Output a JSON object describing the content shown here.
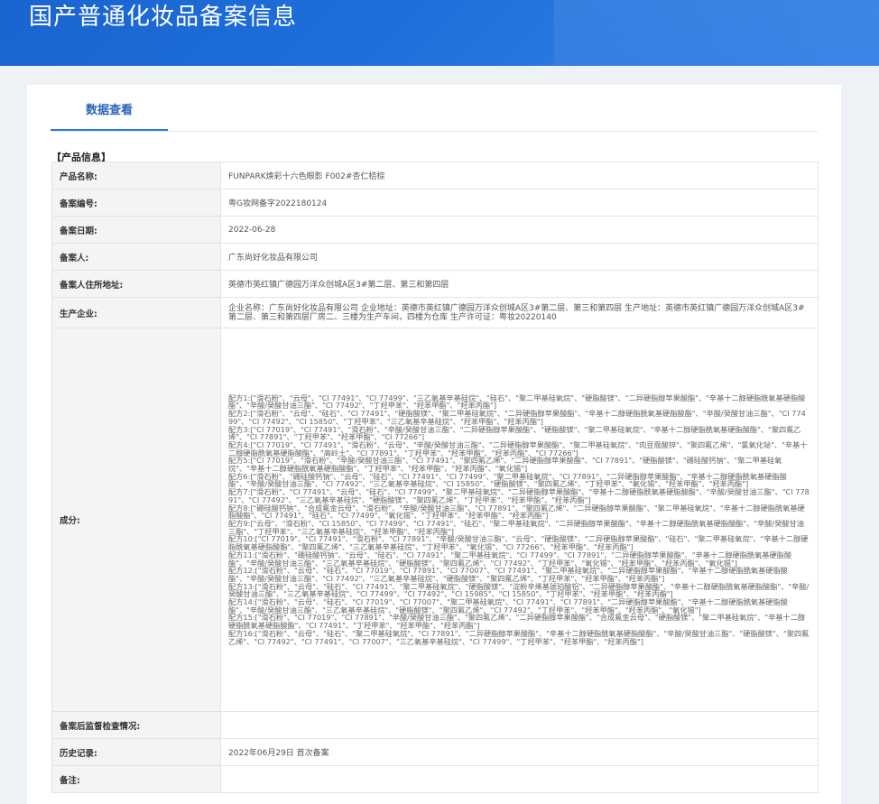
{
  "header": {
    "title": "国产普通化妆品备案信息"
  },
  "tabs": [
    {
      "label": "数据查看"
    }
  ],
  "section": {
    "title": "【产品信息】"
  },
  "fields": {
    "product_name": {
      "label": "产品名称:",
      "value": "FUNPARK焕彩十六色眼影 F002#杏仁桔棕"
    },
    "record_no": {
      "label": "备案编号:",
      "value": "粤G妆网备字2022180124"
    },
    "record_date": {
      "label": "备案日期:",
      "value": "2022-06-28"
    },
    "registrant": {
      "label": "备案人:",
      "value": "广东尚好化妆品有限公司"
    },
    "registrant_address": {
      "label": "备案人住所地址:",
      "value": "英德市英红镇广德园万洋众创城A区3#第二层、第三和第四层"
    },
    "manufacturer": {
      "label": "生产企业:",
      "value": "企业名称：广东尚好化妆品有限公司 企业地址：英德市英红镇广德园万洋众创城A区3#第二层、第三和第四层 生产地址：英德市英红镇广德园万洋众创城A区3#第二层、第三和第四层厂房二、三楼为生产车间，四楼为仓库 生产许可证：粤妆20220140"
    },
    "ingredients": {
      "label": "成分:",
      "lines": [
        "配方1:[\"滑石粉\"、\"云母\"、\"CI 77491\"、\"CI 77499\"、\"三乙氧基辛基硅烷\"、\"硅石\"、\"聚二甲基硅氧烷\"、\"硬脂酸镁\"、\"二异硬脂醇苹果酸酯\"、\"辛基十二醇硬脂酰氧基硬脂酸酯\"、\"辛酸/癸酸甘油三酯\"、\"CI 77492\"、\"丁羟甲苯\"、\"羟苯甲酯\"、\"羟苯丙酯\"]",
        "配方2:[\"滑石粉\"、\"云母\"、\"硅石\"、\"CI 77491\"、\"硬脂酸镁\"、\"聚二甲基硅氧烷\"、\"二异硬脂醇苹果酸酯\"、\"辛基十二醇硬脂酰氧基硬脂酸酯\"、\"辛酸/癸酸甘油三酯\"、\"CI 77499\"、\"CI 77492\"、\"CI 15850\"、\"丁羟甲苯\"、\"三乙氧基辛基硅烷\"、\"羟苯甲酯\"、\"羟苯丙酯\"]",
        "配方3:[\"CI 77019\"、\"CI 77491\"、\"滑石粉\"、\"辛酸/癸酸甘油三酯\"、\"二异硬脂醇苹果酸酯\"、\"硬脂酸镁\"、\"聚二甲基硅氧烷\"、\"辛基十二醇硬脂酰氧基硬脂酸酯\"、\"聚四氟乙烯\"、\"CI 77891\"、\"丁羟甲苯\"、\"羟苯甲酯\"、\"CI 77266\"]",
        "配方4:[\"CI 77019\"、\"CI 77491\"、\"滑石粉\"、\"云母\"、\"辛酸/癸酸甘油三酯\"、\"二异硬脂醇苹果酸酯\"、\"聚二甲基硅氧烷\"、\"肉豆蔻酸锌\"、\"聚四氟乙烯\"、\"氯氧化铋\"、\"辛基十二醇硬脂酰氧基硬脂酸酯\"、\"高岭土\"、\"CI 77891\"、\"丁羟甲苯\"、\"羟苯甲酯\"、\"羟苯丙酯\"、\"CI 77266\"]",
        "配方5:[\"CI 77019\"、\"滑石粉\"、\"辛酸/癸酸甘油三酯\"、\"CI 77491\"、\"聚四氟乙烯\"、\"二异硬脂醇苹果酸酯\"、\"CI 77891\"、\"硬脂酸镁\"、\"硼硅酸钙钠\"、\"聚二甲基硅氧烷\"、\"辛基十二醇硬脂酰氧基硬脂酸酯\"、\"丁羟甲苯\"、\"羟苯甲酯\"、\"羟苯丙酯\"、\"氧化锡\"]",
        "配方6:[\"滑石粉\"、\"硼硅酸钙钠\"、\"云母\"、\"硅石\"、\"CI 77491\"、\"CI 77499\"、\"聚二甲基硅氧烷\"、\"CI 77891\"、\"二异硬脂醇苹果酸酯\"、\"辛基十二醇硬脂酰氧基硬脂酸酯\"、\"辛酸/癸酸甘油三酯\"、\"CI 77492\"、\"三乙氧基辛基硅烷\"、\"CI 15850\"、\"硬脂酸镁\"、\"聚四氟乙烯\"、\"丁羟甲苯\"、\"氧化锡\"、\"羟苯甲酯\"、\"羟苯丙酯\"]",
        "配方7:[\"滑石粉\"、\"CI 77491\"、\"云母\"、\"硅石\"、\"CI 77499\"、\"聚二甲基硅氧烷\"、\"二异硬脂醇苹果酸酯\"、\"辛基十二醇硬脂酰氧基硬脂酸酯\"、\"辛酸/癸酸甘油三酯\"、\"CI 77891\"、\"CI 77492\"、\"三乙氧基辛基硅烷\"、\"硬脂酸镁\"、\"聚四氟乙烯\"、\"丁羟甲苯\"、\"羟苯甲酯\"、\"羟苯丙酯\"]",
        "配方8:[\"硼硅酸钙钠\"、\"合成氟金云母\"、\"滑石粉\"、\"辛酸/癸酸甘油三酯\"、\"CI 77891\"、\"聚四氟乙烯\"、\"二异硬脂醇苹果酸酯\"、\"聚二甲基硅氧烷\"、\"辛基十二醇硬脂酰氧基硬脂酸酯\"、\"CI 77491\"、\"硅石\"、\"CI 77499\"、\"氧化锡\"、\"丁羟甲苯\"、\"羟苯甲酯\"、\"羟苯丙酯\"]",
        "配方9:[\"云母\"、\"滑石粉\"、\"CI 15850\"、\"CI 77499\"、\"CI 77491\"、\"硅石\"、\"聚二甲基硅氧烷\"、\"二异硬脂醇苹果酸酯\"、\"辛基十二醇硬脂酰氧基硬脂酸酯\"、\"辛酸/癸酸甘油三酯\"、\"丁羟甲苯\"、\"三乙氧基辛基硅烷\"、\"羟苯甲酯\"、\"羟苯丙酯\"]",
        "配方10:[\"CI 77019\"、\"CI 77491\"、\"滑石粉\"、\"CI 77891\"、\"辛酸/癸酸甘油三酯\"、\"云母\"、\"硬脂酸镁\"、\"二异硬脂醇苹果酸酯\"、\"硅石\"、\"聚二甲基硅氧烷\"、\"辛基十二醇硬脂酰氧基硬脂酸酯\"、\"聚四氟乙烯\"、\"三乙氧基辛基硅烷\"、\"丁羟甲苯\"、\"氧化锡\"、\"CI 77266\"、\"羟苯甲酯\"、\"羟苯丙酯\"]",
        "配方11:[\"滑石粉\"、\"硼硅酸钙钠\"、\"云母\"、\"硅石\"、\"CI 77491\"、\"聚二甲基硅氧烷\"、\"CI 77499\"、\"CI 77891\"、\"二异硬脂醇苹果酸酯\"、\"辛基十二醇硬脂酰氧基硬脂酸酯\"、\"辛酸/癸酸甘油三酯\"、\"三乙氧基辛基硅烷\"、\"硬脂酸镁\"、\"聚四氟乙烯\"、\"CI 77492\"、\"丁羟甲苯\"、\"氧化锡\"、\"羟苯甲酯\"、\"羟苯丙酯\"、\"氧化锡\"]",
        "配方12:[\"滑石粉\"、\"云母\"、\"硅石\"、\"CI 77019\"、\"CI 77891\"、\"CI 77007\"、\"CI 77491\"、\"聚二甲基硅氧烷\"、\"二异硬脂醇苹果酸酯\"、\"辛基十二醇硬脂酰氧基硬脂酸酯\"、\"辛酸/癸酸甘油三酯\"、\"CI 77492\"、\"三乙氧基辛基硅烷\"、\"硬脂酸镁\"、\"聚四氟乙烯\"、\"丁羟甲苯\"、\"羟苯甲酯\"、\"羟苯丙酯\"]",
        "配方13:[\"滑石粉\"、\"云母\"、\"硅石\"、\"CI 77491\"、\"聚二甲基硅氧烷\"、\"硬脂酸镁\"、\"淀粉辛烯基琥珀酸铝\"、\"二异硬脂醇苹果酸酯\"、\"辛基十二醇硬脂酰氧基硬脂酸酯\"、\"辛酸/癸酸甘油三酯\"、\"三乙氧基辛基硅烷\"、\"CI 77499\"、\"CI 77492\"、\"CI 15985\"、\"CI 15850\"、\"丁羟甲苯\"、\"羟苯甲酯\"、\"羟苯丙酯\"]",
        "配方14:[\"滑石粉\"、\"云母\"、\"硅石\"、\"CI 77019\"、\"CI 77007\"、\"聚二甲基硅氧烷\"、\"CI 77491\"、\"CI 77891\"、\"二异硬脂醇苹果酸酯\"、\"辛基十二醇硬脂酰氧基硬脂酸酯\"、\"辛酸/癸酸甘油三酯\"、\"三乙氧基辛基硅烷\"、\"硬脂酸镁\"、\"聚四氟乙烯\"、\"CI 77492\"、\"丁羟甲苯\"、\"羟苯甲酯\"、\"羟苯丙酯\"、\"氧化锡\"]",
        "配方15:[\"滑石粉\"、\"CI 77019\"、\"CI 77891\"、\"辛酸/癸酸甘油三酯\"、\"聚四氟乙烯\"、\"二异硬脂醇苹果酸酯\"、\"合成氟金云母\"、\"硬脂酸镁\"、\"聚二甲基硅氧烷\"、\"辛基十二醇硬脂酰氧基硬脂酸酯\"、\"CI 77491\"、\"丁羟甲苯\"、\"羟苯甲酯\"、\"羟苯丙酯\"]",
        "配方16:[\"滑石粉\"、\"云母\"、\"硅石\"、\"聚二甲基硅氧烷\"、\"CI 77891\"、\"二异硬脂醇苹果酸酯\"、\"辛基十二醇硬脂酰氧基硬脂酸酯\"、\"辛酸/癸酸甘油三酯\"、\"硬脂酸镁\"、\"聚四氟乙烯\"、\"CI 77492\"、\"CI 77491\"、\"CI 77007\"、\"三乙氧基辛基硅烷\"、\"CI 77499\"、\"丁羟甲苯\"、\"羟苯甲酯\"、\"羟苯丙酯\"]"
      ]
    },
    "post_inspection": {
      "label": "备案后监督检查情况:",
      "value": ""
    },
    "history": {
      "label": "历史记录:",
      "value": "2022年06月29日 首次备案"
    },
    "remarks": {
      "label": "备注:",
      "value": ""
    }
  },
  "colors": {
    "header_bg": "#1e6fdb",
    "tab_active": "#2b63b8",
    "table_border": "#8db3e0"
  }
}
